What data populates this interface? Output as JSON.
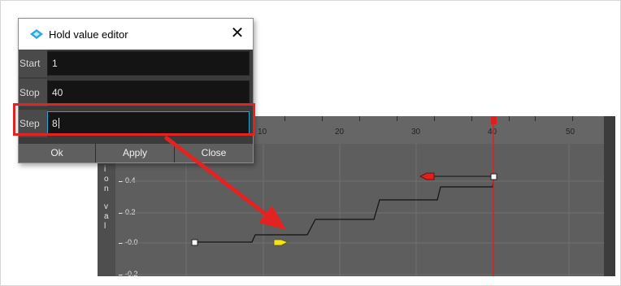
{
  "dialog": {
    "title": "Hold value editor",
    "app_icon": "toonboom-icon",
    "close_glyph": "✕",
    "fields": [
      {
        "label": "Start",
        "value": "1"
      },
      {
        "label": "Stop",
        "value": "40"
      },
      {
        "label": "Step",
        "value": "8"
      }
    ],
    "buttons": {
      "ok": "Ok",
      "apply": "Apply",
      "close": "Close"
    }
  },
  "graph": {
    "ruler_labels": [
      "10",
      "20",
      "30",
      "40",
      "50"
    ],
    "y_labels": [
      "0.4",
      "0.2",
      "-0.0",
      "-0.2"
    ],
    "y_axis_title": "ction val",
    "current_frame": "40"
  },
  "colors": {
    "highlight": "#e32222",
    "arrow": "#e32222",
    "playhead": "#e01e1e",
    "focus_border": "#2fa3cf"
  }
}
